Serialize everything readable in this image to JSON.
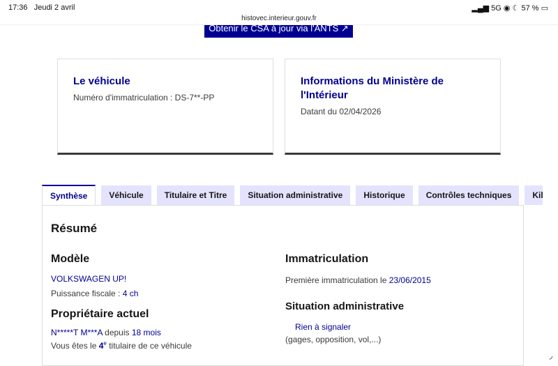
{
  "status_bar": {
    "time": "17:36",
    "date": "Jeudi 2 avril",
    "indicators": "5G",
    "battery": "57 %"
  },
  "browser": {
    "url": "histovec.interieur.gouv.fr"
  },
  "cta": {
    "label": "Obtenir le CSA à jour via l'ANTS ↗"
  },
  "cards": [
    {
      "title": "Le véhicule",
      "text": "Numéro d'immatriculation : DS-7**-PP"
    },
    {
      "title": "Informations du Ministère de l'Intérieur",
      "text": "Datant du 02/04/2026"
    }
  ],
  "tabs": [
    "Synthèse",
    "Véhicule",
    "Titulaire et Titre",
    "Situation administrative",
    "Historique",
    "Contrôles techniques",
    "Kil"
  ],
  "summary": {
    "title": "Résumé",
    "model_heading": "Modèle",
    "model": "VOLKSWAGEN UP!",
    "power_label": "Puissance fiscale : ",
    "power": "4 ch",
    "owner_heading": "Propriétaire actuel",
    "owner": "N*****T M***A",
    "since_label": " depuis ",
    "since": "18 mois",
    "holder_pre": "Vous êtes le ",
    "holder_num": "4",
    "holder_sup": "e",
    "holder_post": " titulaire de ce véhicule",
    "immat_heading": "Immatriculation",
    "first_immat_label": "Première immatriculation le ",
    "first_immat": "23/06/2015",
    "admin_heading": "Situation administrative",
    "admin_status": "Rien à signaler",
    "admin_note": "(gages, opposition, vol,...)"
  }
}
